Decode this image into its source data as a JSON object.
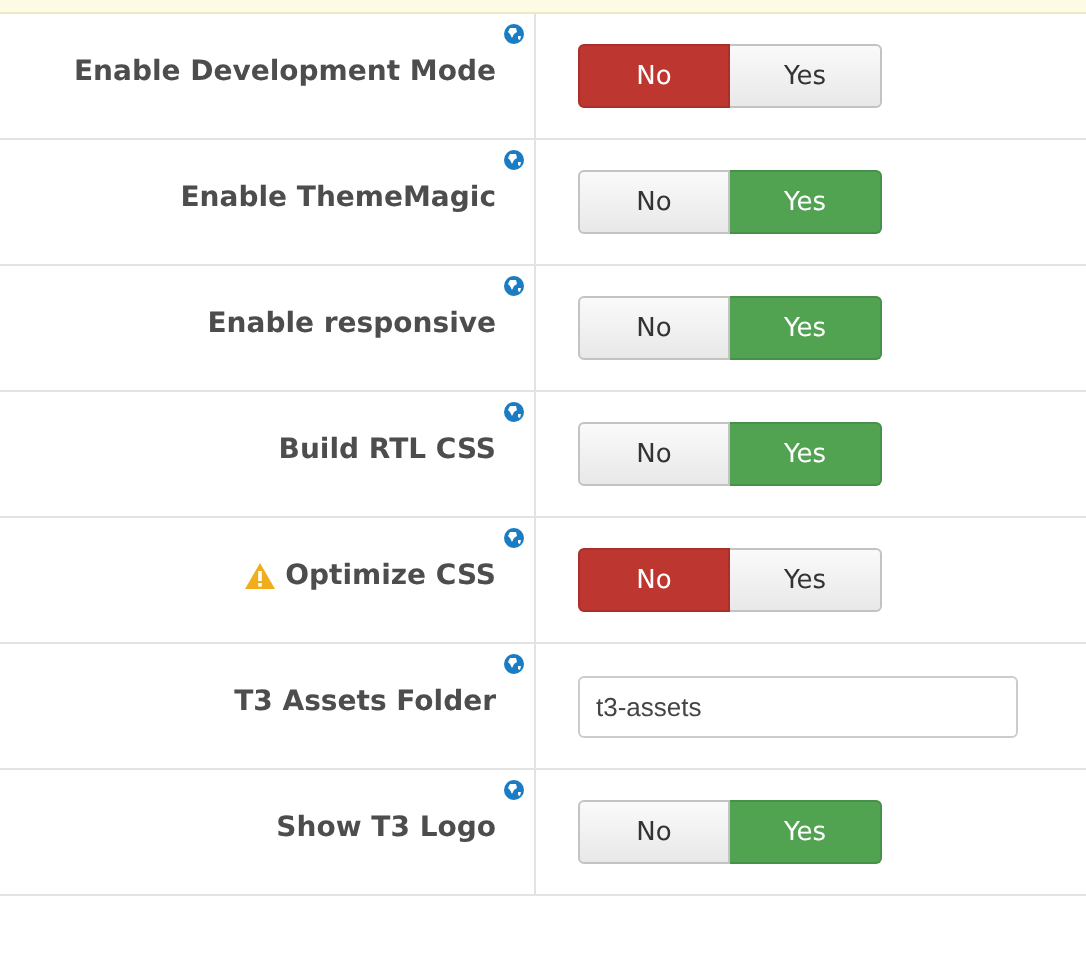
{
  "settings": [
    {
      "kind": "toggle",
      "label": "Enable Development Mode",
      "warning": false,
      "options": [
        {
          "label": "No",
          "selected": true
        },
        {
          "label": "Yes",
          "selected": false
        }
      ]
    },
    {
      "kind": "toggle",
      "label": "Enable ThemeMagic",
      "warning": false,
      "options": [
        {
          "label": "No",
          "selected": false
        },
        {
          "label": "Yes",
          "selected": true
        }
      ]
    },
    {
      "kind": "toggle",
      "label": "Enable responsive",
      "warning": false,
      "options": [
        {
          "label": "No",
          "selected": false
        },
        {
          "label": "Yes",
          "selected": true
        }
      ]
    },
    {
      "kind": "toggle",
      "label": "Build RTL CSS",
      "warning": false,
      "options": [
        {
          "label": "No",
          "selected": false
        },
        {
          "label": "Yes",
          "selected": true
        }
      ]
    },
    {
      "kind": "toggle",
      "label": "Optimize CSS",
      "warning": true,
      "options": [
        {
          "label": "No",
          "selected": true
        },
        {
          "label": "Yes",
          "selected": false
        }
      ]
    },
    {
      "kind": "text",
      "label": "T3 Assets Folder",
      "warning": false,
      "value": "t3-assets"
    },
    {
      "kind": "toggle",
      "label": "Show T3 Logo",
      "warning": false,
      "options": [
        {
          "label": "No",
          "selected": false
        },
        {
          "label": "Yes",
          "selected": true
        }
      ]
    }
  ]
}
